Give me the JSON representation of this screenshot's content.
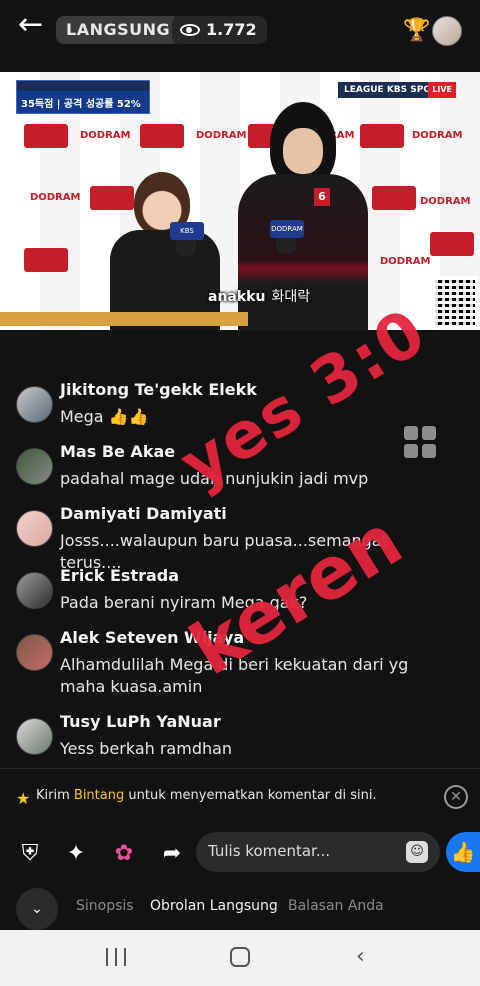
{
  "topbar": {
    "back_icon": "arrow-left-icon",
    "live_label": "LANGSUNG",
    "view_count": "1.772"
  },
  "video": {
    "scoreboard_line": "35득점 | 공격 성공률 52%",
    "broadcaster": "LEAGUE KBS SPORTS",
    "live_badge": "LIVE",
    "brand": "DODRAM",
    "caption": "anakku",
    "caption_korean": "화대락",
    "jersey_number": "6",
    "mic_label": "KBS"
  },
  "comments": [
    {
      "name": "Jikitong Te'gekk Elekk",
      "text": "Mega 👍👍"
    },
    {
      "name": "Mas Be Akae",
      "text": "padahal mage udah nunjukin jadi mvp"
    },
    {
      "name": "Damiyati Damiyati",
      "text": "Josss....walaupun baru puasa...semangat terus...."
    },
    {
      "name": "Erick Estrada",
      "text": "Pada berani nyiram Mega gak?"
    },
    {
      "name": "Alek Seteven Wijaya",
      "text": "Alhamdulilah Mega di beri kekuatan dari yg maha kuasa.amin"
    },
    {
      "name": "Tusy LuPh YaNuar",
      "text": "Yess berkah ramdhan"
    }
  ],
  "overlay": {
    "line1": "yes 3:0",
    "line2": "keren"
  },
  "pin_bar": {
    "prefix": "Kirim",
    "link": "Bintang",
    "suffix": "untuk menyematkan komentar di sini."
  },
  "composer": {
    "placeholder": "Tulis komentar..."
  },
  "tabs": [
    "Sinopsis",
    "Obrolan Langsung",
    "Balasan Anda"
  ],
  "colors": {
    "accent_red": "#c61d2b",
    "overlay_red": "#e3263d",
    "facebook_blue": "#1877f2",
    "star_gold": "#f5c518"
  }
}
